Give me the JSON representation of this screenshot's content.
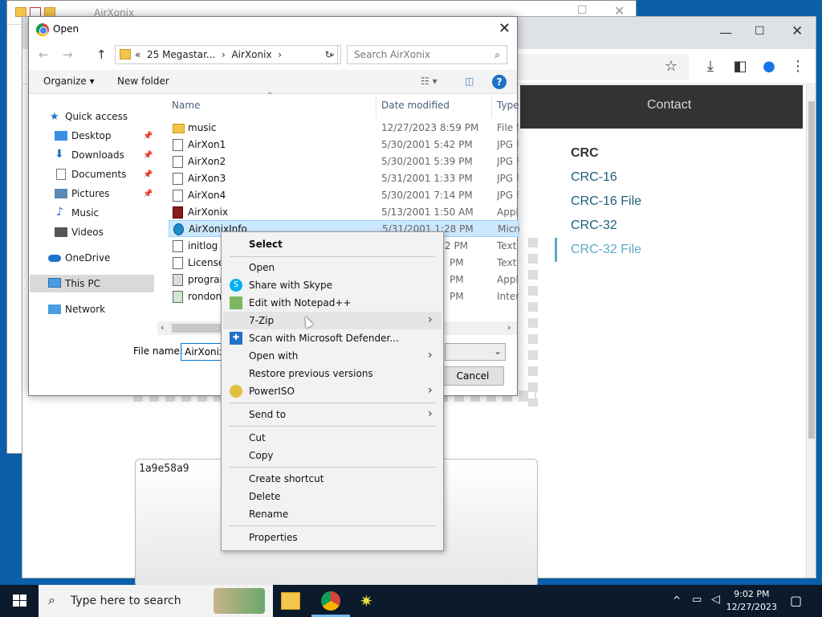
{
  "background_window": {
    "title": "AirXonix"
  },
  "chrome": {
    "nav": {
      "contact": "Contact"
    },
    "crc_links": [
      "CRC",
      "CRC-16",
      "CRC-16 File",
      "CRC-32",
      "CRC-32 File"
    ],
    "result_text": "1a9e58a9"
  },
  "dialog": {
    "title": "Open",
    "breadcrumb": {
      "prefix": "«",
      "part1": "25 Megastar...",
      "sep": "›",
      "part2": "AirXonix",
      "sep2": "›"
    },
    "search_placeholder": "Search AirXonix",
    "organize": "Organize ▾",
    "new_folder": "New folder",
    "nav_items": [
      {
        "label": "Quick access"
      },
      {
        "label": "Desktop"
      },
      {
        "label": "Downloads"
      },
      {
        "label": "Documents"
      },
      {
        "label": "Pictures"
      },
      {
        "label": "Music"
      },
      {
        "label": "Videos"
      },
      {
        "label": "OneDrive"
      },
      {
        "label": "This PC"
      },
      {
        "label": "Network"
      }
    ],
    "columns": {
      "name": "Name",
      "date": "Date modified",
      "type": "Type"
    },
    "files": [
      {
        "name": "music",
        "date": "12/27/2023 8:59 PM",
        "type": "File f"
      },
      {
        "name": "AirXon1",
        "date": "5/30/2001 5:42 PM",
        "type": "JPG F"
      },
      {
        "name": "AirXon2",
        "date": "5/30/2001 5:39 PM",
        "type": "JPG F"
      },
      {
        "name": "AirXon3",
        "date": "5/31/2001 1:33 PM",
        "type": "JPG F"
      },
      {
        "name": "AirXon4",
        "date": "5/30/2001 7:14 PM",
        "type": "JPG F"
      },
      {
        "name": "AirXonix",
        "date": "5/13/2001 1:50 AM",
        "type": "Appli"
      },
      {
        "name": "AirXonixInfo",
        "date": "5/31/2001 1:28 PM",
        "type": "Micro"
      },
      {
        "name": "initlog",
        "date": "2 PM",
        "type": "Text D"
      },
      {
        "name": "License",
        "date": "PM",
        "type": "Text D"
      },
      {
        "name": "program",
        "date": "PM",
        "type": "Appli"
      },
      {
        "name": "rondom",
        "date": "PM",
        "type": "Intern"
      }
    ],
    "file_name_label": "File name:",
    "file_name_value": "AirXonix",
    "cancel": "Cancel"
  },
  "context_menu": {
    "items": {
      "select": "Select",
      "open": "Open",
      "share_skype": "Share with Skype",
      "edit_npp": "Edit with Notepad++",
      "seven_zip": "7-Zip",
      "scan_defender": "Scan with Microsoft Defender...",
      "open_with": "Open with",
      "restore": "Restore previous versions",
      "poweriso": "PowerISO",
      "send_to": "Send to",
      "cut": "Cut",
      "copy": "Copy",
      "create_shortcut": "Create shortcut",
      "delete": "Delete",
      "rename": "Rename",
      "properties": "Properties"
    }
  },
  "taskbar": {
    "search_placeholder": "Type here to search",
    "time": "9:02 PM",
    "date": "12/27/2023"
  },
  "colors": {
    "accent": "#0078d7",
    "selection": "#cce8ff",
    "taskbar": "#0b1b2c",
    "link": "#1f5f7a"
  }
}
